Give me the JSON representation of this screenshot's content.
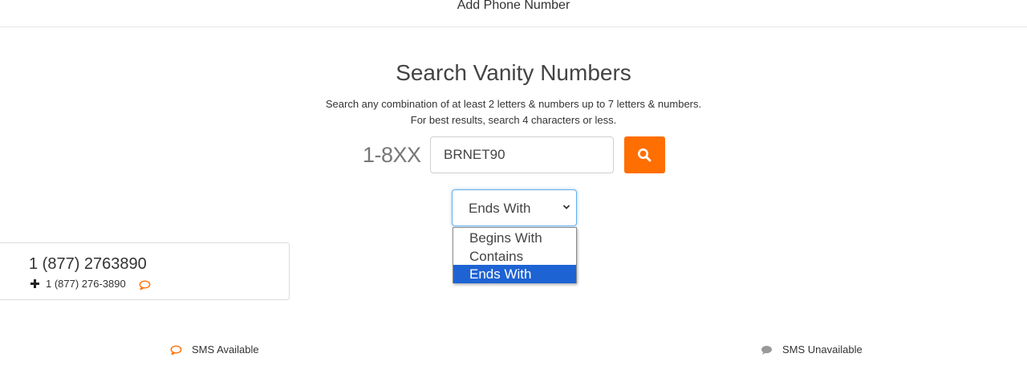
{
  "header": {
    "title": "Add Phone Number"
  },
  "search": {
    "title": "Search Vanity Numbers",
    "description_line1": "Search any combination of at least 2 letters & numbers up to 7 letters & numbers.",
    "description_line2": "For best results, search 4 characters or less.",
    "prefix": "1-8XX",
    "input_value": "BRNET90",
    "button_icon": "search-icon",
    "button_color": "#ff6e00"
  },
  "match_select": {
    "selected": "Ends With",
    "options": [
      "Begins With",
      "Contains",
      "Ends With"
    ],
    "highlighted_index": 2,
    "highlight_color": "#1e63d3"
  },
  "results": [
    {
      "number_display": "1 (877) 2763890",
      "number_formatted": "1 (877) 276-3890",
      "sms_available": true
    }
  ],
  "legend": {
    "sms_available": "SMS Available",
    "sms_unavailable": "SMS Unavailable",
    "available_color": "#ff6e00",
    "unavailable_color": "#999999"
  }
}
